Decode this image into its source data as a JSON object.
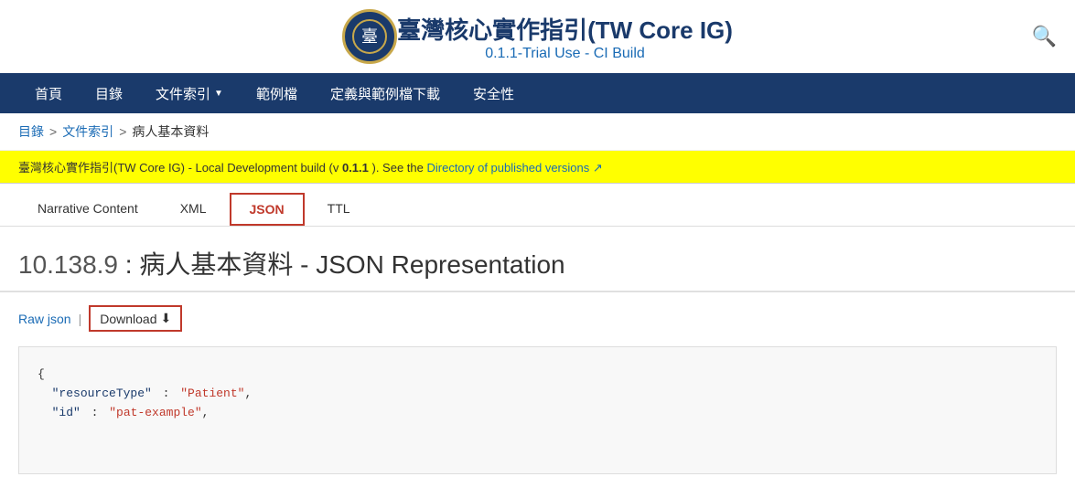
{
  "header": {
    "title_main": "臺灣核心實作指引(TW Core IG)",
    "title_sub": "0.1.1-Trial Use - CI Build",
    "search_icon": "🔍"
  },
  "nav": {
    "items": [
      {
        "id": "home",
        "label": "首頁",
        "has_dropdown": false
      },
      {
        "id": "toc",
        "label": "目錄",
        "has_dropdown": false
      },
      {
        "id": "doc-index",
        "label": "文件索引",
        "has_dropdown": true
      },
      {
        "id": "examples",
        "label": "範例檔",
        "has_dropdown": false
      },
      {
        "id": "definitions",
        "label": "定義與範例檔下載",
        "has_dropdown": false
      },
      {
        "id": "security",
        "label": "安全性",
        "has_dropdown": false
      }
    ]
  },
  "breadcrumb": {
    "items": [
      {
        "label": "目錄",
        "link": true
      },
      {
        "label": "文件索引",
        "link": true
      },
      {
        "label": "病人基本資料",
        "link": false
      }
    ],
    "separators": [
      ">",
      ">"
    ]
  },
  "warning": {
    "text_before": "臺灣核心實作指引(TW Core IG) - Local Development build (v ",
    "version": "0.1.1",
    "text_after": " ). See the ",
    "link_label": "Directory of published versions",
    "link_icon": "↗"
  },
  "tabs": [
    {
      "id": "narrative",
      "label": "Narrative Content",
      "active": false
    },
    {
      "id": "xml",
      "label": "XML",
      "active": false
    },
    {
      "id": "json",
      "label": "JSON",
      "active": true
    },
    {
      "id": "ttl",
      "label": "TTL",
      "active": false
    }
  ],
  "page_title": {
    "number": "10.138.9",
    "colon": ":",
    "text": "病人基本資料 - JSON Representation"
  },
  "actions": {
    "raw_json": "Raw json",
    "download": "Download",
    "download_icon": "⬇"
  },
  "code": {
    "lines": [
      {
        "type": "brace",
        "content": "{"
      },
      {
        "type": "key-string",
        "key": "\"resourceType\"",
        "value": "\"Patient\""
      },
      {
        "type": "key-string",
        "key": "\"id\"",
        "value": "\"pat-example\""
      }
    ]
  }
}
